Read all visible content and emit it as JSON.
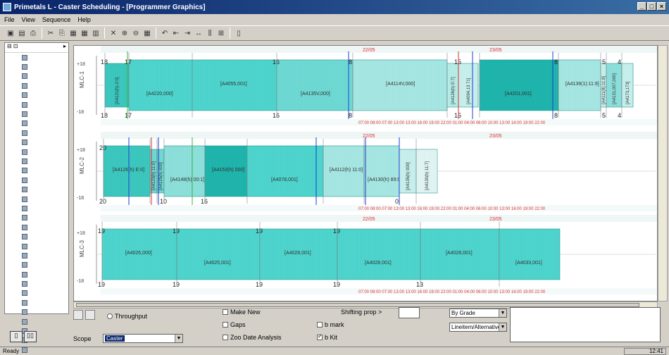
{
  "window": {
    "title": "Primetals L - Caster Scheduling - [Programmer Graphics]"
  },
  "menu": [
    "File",
    "View",
    "Sequence",
    "Help"
  ],
  "toolbar_icons": [
    "open-icon",
    "save-icon",
    "print-icon",
    "cut-icon",
    "copy-icon",
    "paste-icon",
    "grid-icon",
    "chart-icon",
    "close-icon",
    "insert-icon",
    "delete-icon",
    "calendar-icon",
    "undo-icon",
    "align-left-icon",
    "align-right-icon",
    "move-icon",
    "split-icon",
    "merge-icon",
    "document-icon"
  ],
  "sidebar": {
    "header_left": "⊟ ⊡",
    "header_right": "▸"
  },
  "strands": [
    {
      "label": "MLC-1",
      "ytop": "+18",
      "ybot": "-18",
      "date1": "22/05",
      "date2": "23/05",
      "times": "07:00 08:00 07:00 13:00 13:00 16:00 19:00 22:00 01:00 04:00 06:00 10:00 13:00 16:00 19:00 22:00",
      "blocks": [
        {
          "label": "[A4121(h)-2:0]",
          "color": "#3cc8c0",
          "top": "18",
          "bot": "18"
        },
        {
          "label": "[A4220,000]",
          "color": "#4fd6cf",
          "top": "17",
          "bot": "17"
        },
        {
          "label": "[A4055,001]",
          "color": "#4fd6cf",
          "top": "",
          "bot": ""
        },
        {
          "label": "[A4135V,000]",
          "color": "#6fdad5",
          "top": "16",
          "bot": "16"
        },
        {
          "label": "[A4114V,000]",
          "color": "#a8e8e4",
          "top": "8",
          "bot": "8"
        },
        {
          "label": "[A4126(h) E:7]",
          "color": "#b8eeea",
          "top": "",
          "bot": ""
        },
        {
          "label": "[A4094,13 71]",
          "color": "#c9f1ee",
          "top": "15",
          "bot": "15"
        },
        {
          "label": "[A4201,001]",
          "color": "#1fb5ad",
          "top": "",
          "bot": ""
        },
        {
          "label": "[A4139(1):11:9]",
          "color": "#a8e8e4",
          "top": "8",
          "bot": "8"
        },
        {
          "label": "[A4111(8):11:8]",
          "color": "#c9f1ee",
          "top": "",
          "bot": ""
        },
        {
          "label": "[A4131,007,000]",
          "color": "#8fe1dc",
          "top": "5",
          "bot": "5"
        },
        {
          "label": "[A4173,173]",
          "color": "#c9f1ee",
          "top": "4",
          "bot": "4"
        }
      ]
    },
    {
      "label": "MLC-2",
      "ytop": "+18",
      "ybot": "-18",
      "date1": "22/05",
      "date2": "23/05",
      "times": "07:00 08:00 07:00 13:00 13:00 16:00 19:00 22:00 01:00 04:00 06:00 10:00 13:00 16:00 19:00 22:00",
      "blocks": [
        {
          "label": "[A4126(h) E:0]",
          "color": "#3cc8c0",
          "top": "20",
          "bot": "20"
        },
        {
          "label": "[A4123(h) 11:0]",
          "color": "#6fdad5",
          "top": "",
          "bot": ""
        },
        {
          "label": "[A4125(h) 000]",
          "color": "#6fdad5",
          "top": "",
          "bot": ""
        },
        {
          "label": "[A4148(h) 00:1]",
          "color": "#8fe1dc",
          "top": "",
          "bot": "10"
        },
        {
          "label": "[A4153(h) 000]",
          "color": "#1fb5ad",
          "top": "",
          "bot": "16"
        },
        {
          "label": "[A4078,001]",
          "color": "#4fd6cf",
          "top": "",
          "bot": ""
        },
        {
          "label": "[A4112(h) 11:0]",
          "color": "#a8e8e4",
          "top": "",
          "bot": ""
        },
        {
          "label": "[A4130(h) 89:0]",
          "color": "#a8e8e4",
          "top": "",
          "bot": ""
        },
        {
          "label": "[A4135(h) 000]",
          "color": "#c9f1ee",
          "top": "",
          "bot": "0"
        },
        {
          "label": "[A4130(h) 11:7]",
          "color": "#e3f7f5",
          "top": "",
          "bot": ""
        }
      ]
    },
    {
      "label": "MLC-3",
      "ytop": "+18",
      "ybot": "-18",
      "date1": "22/05",
      "date2": "23/05",
      "times": "07:00 08:00 07:00 13:00 13:00 16:00 19:00 22:00 01:00 04:00 06:00 10:00 13:00 16:00 19:00 22:00",
      "blocks": [
        {
          "label": "[A4026,000]",
          "color": "#4fd6cf",
          "top": "19",
          "bot": "19"
        },
        {
          "label": "[A4025,001]",
          "color": "#4fd6cf",
          "top": "19",
          "bot": "19"
        },
        {
          "label": "[A4028,001]",
          "color": "#4fd6cf",
          "top": "19",
          "bot": "19"
        },
        {
          "label": "[A4028,001]",
          "color": "#4fd6cf",
          "top": "19",
          "bot": "19"
        },
        {
          "label": "[A4028,001]",
          "color": "#4fd6cf",
          "top": "",
          "bot": "13"
        },
        {
          "label": "[A4033,001]",
          "color": "#4fd6cf",
          "top": "",
          "bot": ""
        }
      ]
    }
  ],
  "controls": {
    "throughput_label": "Throughput",
    "make_new_label": "Make New",
    "gaps_label": "Gaps",
    "zoo_date_analysis_label": "Zoo Date Analysis",
    "shifting_prop_label": "Shifting prop >",
    "b_mark_label": "b mark",
    "b_kit_label": "b Kit",
    "sort_select": "By Grade",
    "filter_select": "Lineitem/Alternative",
    "scope_label": "Scope",
    "scope_select": "Caster"
  },
  "status": {
    "left": "Ready",
    "right": "12:41"
  }
}
